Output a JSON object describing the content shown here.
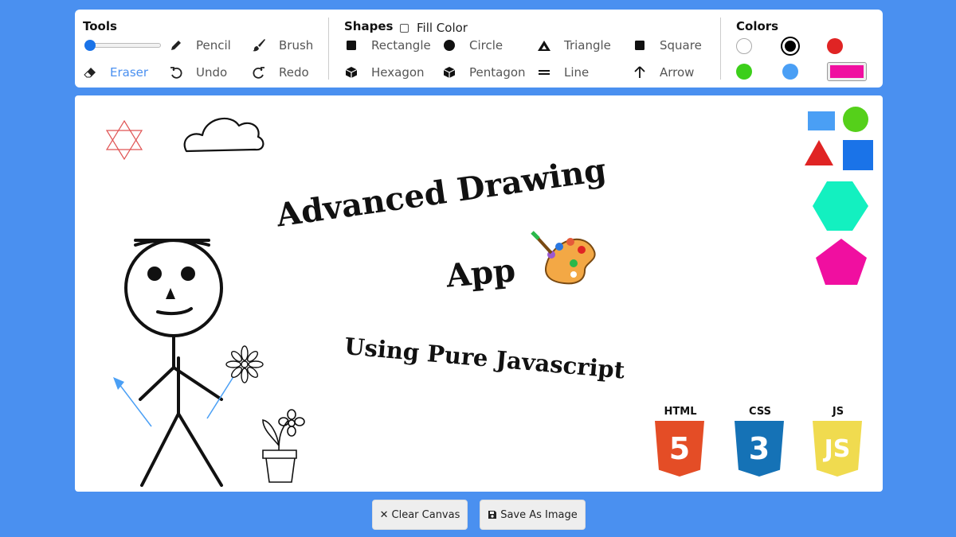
{
  "toolbar": {
    "tools_title": "Tools",
    "shapes_title": "Shapes",
    "colors_title": "Colors",
    "brush_size": 0,
    "tools": [
      {
        "label": "Pencil",
        "icon": "pencil-icon"
      },
      {
        "label": "Brush",
        "icon": "brush-icon"
      },
      {
        "label": "Eraser",
        "icon": "eraser-icon",
        "active": true
      },
      {
        "label": "Undo",
        "icon": "undo-icon"
      },
      {
        "label": "Redo",
        "icon": "redo-icon"
      }
    ],
    "fill_color_label": "Fill Color",
    "fill_color_checked": false,
    "shapes": [
      "Rectangle",
      "Circle",
      "Triangle",
      "Square",
      "Hexagon",
      "Pentagon",
      "Line",
      "Arrow"
    ],
    "colors": [
      "#ffffff",
      "#000000",
      "#e02424",
      "#3ccf1a",
      "#4a9ff5"
    ],
    "selected_color": "#000000",
    "custom_color": "#f00fa0"
  },
  "canvas": {
    "title_line1": "Advanced Drawing",
    "title_line2": "App",
    "subtitle": "Using Pure Javascript",
    "badges": [
      "HTML",
      "CSS",
      "JS"
    ],
    "badge_digits": [
      "5",
      "3",
      "JS"
    ]
  },
  "actions": {
    "clear_label": "Clear Canvas",
    "save_label": "Save As Image"
  },
  "theme": {
    "background": "#4a90f0",
    "accent": "#4a90f0",
    "html_color": "#e44d26",
    "css_color": "#1572b6",
    "js_color": "#f0db4f"
  }
}
